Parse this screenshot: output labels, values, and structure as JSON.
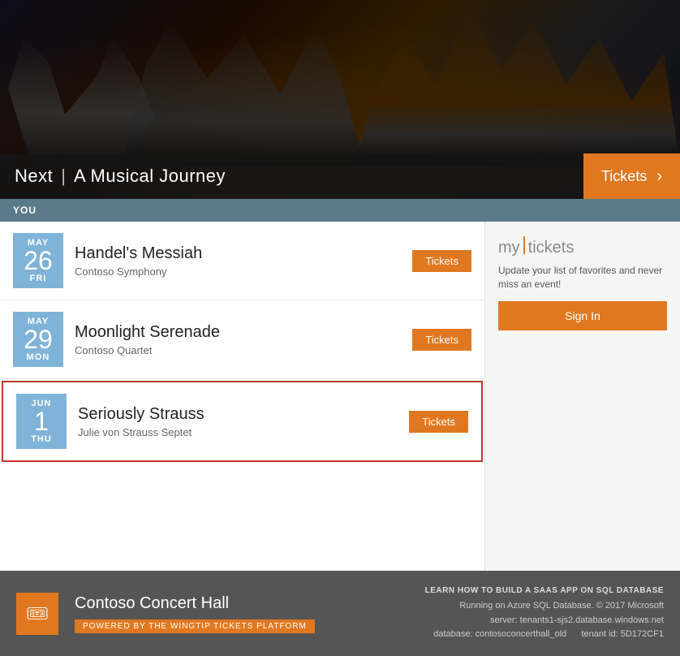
{
  "hero": {
    "title_next": "Next",
    "title_divider": "|",
    "title_main": "A Musical Journey",
    "tickets_label": "Tickets",
    "tickets_chevron": "›"
  },
  "top_bar": {
    "label": "YOU"
  },
  "events": [
    {
      "month": "MAY",
      "day": "26",
      "weekday": "FRI",
      "title": "Handel's Messiah",
      "subtitle": "Contoso Symphony",
      "tickets_label": "Tickets",
      "highlighted": false
    },
    {
      "month": "MAY",
      "day": "29",
      "weekday": "MON",
      "title": "Moonlight Serenade",
      "subtitle": "Contoso Quartet",
      "tickets_label": "Tickets",
      "highlighted": false
    },
    {
      "month": "JUN",
      "day": "1",
      "weekday": "THU",
      "title": "Seriously Strauss",
      "subtitle": "Julie von Strauss Septet",
      "tickets_label": "Tickets",
      "highlighted": true
    }
  ],
  "sidebar": {
    "my_label": "my",
    "tickets_label": "tickets",
    "description": "Update your list of favorites and never miss an event!",
    "sign_in_label": "Sign In"
  },
  "footer": {
    "logo_icon": "🎟",
    "venue_name": "Contoso Concert Hall",
    "powered_by": "POWERED BY THE WINGTIP TICKETS PLATFORM",
    "learn_how": "LEARN HOW TO BUILD A SAAS APP ON SQL DATABASE",
    "running_on": "Running on Azure SQL Database. © 2017 Microsoft",
    "server": "server: tenants1-sjs2.database.windows.net",
    "database": "database: contosoconcerthall_old",
    "tenant_id": "tenant id: 5D172CF1"
  }
}
